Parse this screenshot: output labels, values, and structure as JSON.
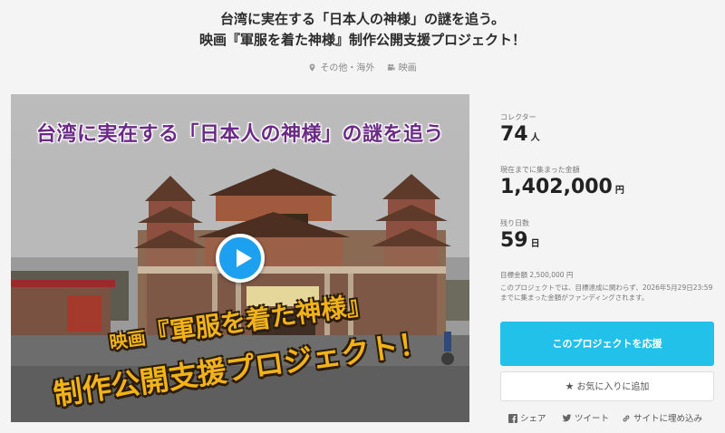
{
  "project": {
    "title_line1": "台湾に実在する「日本人の神様」の謎を追う。",
    "title_line2": "映画『軍服を着た神様』制作公開支援プロジェクト！",
    "location": "その他・海外",
    "category": "映画",
    "location_icon": "map-pin-icon",
    "category_icon": "film-camera-icon"
  },
  "video": {
    "overlay_line1": "台湾に実在する「日本人の神様」の謎を追う",
    "overlay_line2_prefix": "映画",
    "overlay_line2_main": "『軍服を着た神様』",
    "overlay_line3": "制作公開支援プロジェクト！",
    "play_color": "#1ea0f0"
  },
  "stats": {
    "collectors_label": "コレクター",
    "collectors_value": "74",
    "collectors_unit": "人",
    "raised_label": "現在までに集まった金額",
    "raised_value": "1,402,000",
    "raised_unit": "円",
    "days_label": "残り日数",
    "days_value": "59",
    "days_unit": "日",
    "goal_text": "目標金額 2,500,000 円",
    "goal_note": "このプロジェクトでは、目標達成に関わらず、2026年5月29日23:59までに集まった金額がファンディングされます。"
  },
  "actions": {
    "back_label": "このプロジェクトを応援",
    "back_color": "#22c1ea",
    "fav_label": "お気に入りに追加",
    "share_facebook": "シェア",
    "share_twitter": "ツイート",
    "share_embed": "サイトに埋め込み"
  }
}
